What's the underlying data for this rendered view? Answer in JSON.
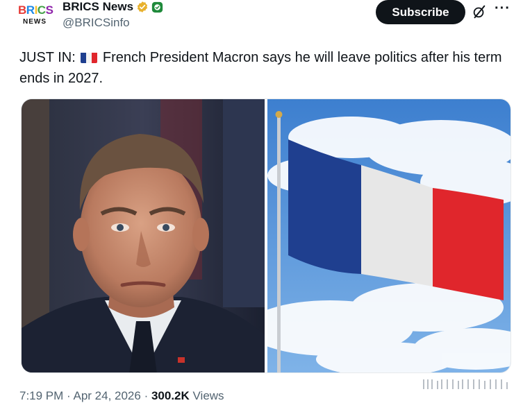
{
  "author": {
    "display_name": "BRICS News",
    "handle": "@BRICSinfo",
    "avatar_text": "BRICS",
    "avatar_subtext": "NEWS",
    "verified": true,
    "avatar_colors": [
      "#e53935",
      "#1e88e5",
      "#43a047",
      "#fdd835",
      "#8e24aa"
    ]
  },
  "actions": {
    "subscribe_label": "Subscribe",
    "grok_icon": "grok-icon",
    "more_icon": "more-icon"
  },
  "tweet": {
    "text_prefix": "JUST IN:",
    "flag": "french-flag-emoji",
    "text_body": "French President  Macron says he will leave politics after his term ends in 2027."
  },
  "media": [
    {
      "kind": "photo",
      "subject": "portrait"
    },
    {
      "kind": "photo",
      "subject": "flag-of-france"
    }
  ],
  "meta": {
    "time": "7:19 PM",
    "separator": " · ",
    "date": "Apr 24, 2026",
    "views_count": "300.2K",
    "views_label": "Views"
  },
  "colors": {
    "text": "#0f1419",
    "secondary": "#536471",
    "verified_gold": "#e8b12d",
    "affiliation_green": "#1f8a3b",
    "flag_blue": "#1f3f8f",
    "flag_white": "#f4f4f4",
    "flag_red": "#e0262c",
    "sky": "#4a8fd6"
  }
}
